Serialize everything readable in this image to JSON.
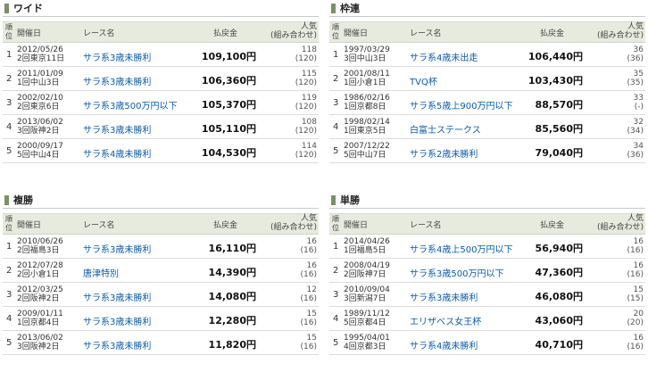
{
  "header_labels": {
    "rank": "順位",
    "date": "開催日",
    "race": "レース名",
    "payout": "払戻金",
    "pop": "人気",
    "combo": "(組み合わせ)"
  },
  "panels": [
    {
      "title": "ワイド",
      "rows": [
        {
          "rank": "1",
          "date": "2012/05/26",
          "venue": "2回東京11日",
          "race": "サラ系3歳未勝利",
          "payout": "109,100円",
          "pop": "118",
          "combo": "(120)"
        },
        {
          "rank": "2",
          "date": "2011/01/09",
          "venue": "1回中山3日",
          "race": "サラ系3歳未勝利",
          "payout": "106,360円",
          "pop": "115",
          "combo": "(120)"
        },
        {
          "rank": "3",
          "date": "2002/02/10",
          "venue": "2回東京6日",
          "race": "サラ系3歳500万円以下",
          "payout": "105,370円",
          "pop": "119",
          "combo": "(120)"
        },
        {
          "rank": "4",
          "date": "2013/06/02",
          "venue": "3回阪神2日",
          "race": "サラ系3歳未勝利",
          "payout": "105,110円",
          "pop": "108",
          "combo": "(120)"
        },
        {
          "rank": "5",
          "date": "2000/09/17",
          "venue": "5回中山4日",
          "race": "サラ系4歳未勝利",
          "payout": "104,530円",
          "pop": "114",
          "combo": "(120)"
        }
      ]
    },
    {
      "title": "枠連",
      "rows": [
        {
          "rank": "1",
          "date": "1997/03/29",
          "venue": "3回中山3日",
          "race": "サラ系4歳未出走",
          "payout": "106,440円",
          "pop": "36",
          "combo": "(36)"
        },
        {
          "rank": "2",
          "date": "2001/08/11",
          "venue": "1回小倉1日",
          "race": "TVQ杯",
          "payout": "103,430円",
          "pop": "35",
          "combo": "(35)"
        },
        {
          "rank": "3",
          "date": "1986/02/16",
          "venue": "1回京都8日",
          "race": "サラ系5歳上900万円以下",
          "payout": "88,570円",
          "pop": "33",
          "combo": "(-)"
        },
        {
          "rank": "4",
          "date": "1998/02/14",
          "venue": "1回東京5日",
          "race": "白富士ステークス",
          "payout": "85,560円",
          "pop": "32",
          "combo": "(34)"
        },
        {
          "rank": "5",
          "date": "2007/12/22",
          "venue": "5回中山7日",
          "race": "サラ系2歳未勝利",
          "payout": "79,040円",
          "pop": "34",
          "combo": "(36)"
        }
      ]
    },
    {
      "title": "複勝",
      "rows": [
        {
          "rank": "1",
          "date": "2010/06/26",
          "venue": "2回福島3日",
          "race": "サラ系3歳未勝利",
          "payout": "16,110円",
          "pop": "16",
          "combo": "(16)"
        },
        {
          "rank": "2",
          "date": "2012/07/28",
          "venue": "2回小倉1日",
          "race": "唐津特別",
          "payout": "14,390円",
          "pop": "16",
          "combo": "(16)"
        },
        {
          "rank": "3",
          "date": "2012/03/25",
          "venue": "2回阪神2日",
          "race": "サラ系3歳未勝利",
          "payout": "14,080円",
          "pop": "12",
          "combo": "(16)"
        },
        {
          "rank": "4",
          "date": "2009/01/11",
          "venue": "1回京都4日",
          "race": "サラ系3歳未勝利",
          "payout": "12,280円",
          "pop": "15",
          "combo": "(16)"
        },
        {
          "rank": "5",
          "date": "2013/06/02",
          "venue": "3回阪神2日",
          "race": "サラ系3歳未勝利",
          "payout": "11,820円",
          "pop": "15",
          "combo": "(16)"
        }
      ]
    },
    {
      "title": "単勝",
      "rows": [
        {
          "rank": "1",
          "date": "2014/04/26",
          "venue": "1回福島5日",
          "race": "サラ系4歳上500万円以下",
          "payout": "56,940円",
          "pop": "16",
          "combo": "(16)"
        },
        {
          "rank": "2",
          "date": "2008/04/19",
          "venue": "2回阪神7日",
          "race": "サラ系3歳500万円以下",
          "payout": "47,360円",
          "pop": "16",
          "combo": "(16)"
        },
        {
          "rank": "3",
          "date": "2010/09/04",
          "venue": "3回新潟7日",
          "race": "サラ系3歳未勝利",
          "payout": "46,080円",
          "pop": "15",
          "combo": "(15)"
        },
        {
          "rank": "4",
          "date": "1989/11/12",
          "venue": "5回京都4日",
          "race": "エリザベス女王杯",
          "payout": "43,060円",
          "pop": "20",
          "combo": "(20)"
        },
        {
          "rank": "5",
          "date": "1995/04/01",
          "venue": "4回京都3日",
          "race": "サラ系4歳未勝利",
          "payout": "40,710円",
          "pop": "16",
          "combo": "(16)"
        }
      ]
    }
  ],
  "colors": {
    "header_bg": "#e7ebde",
    "link": "#0b5cab",
    "title_marker": "#7d8f66"
  }
}
